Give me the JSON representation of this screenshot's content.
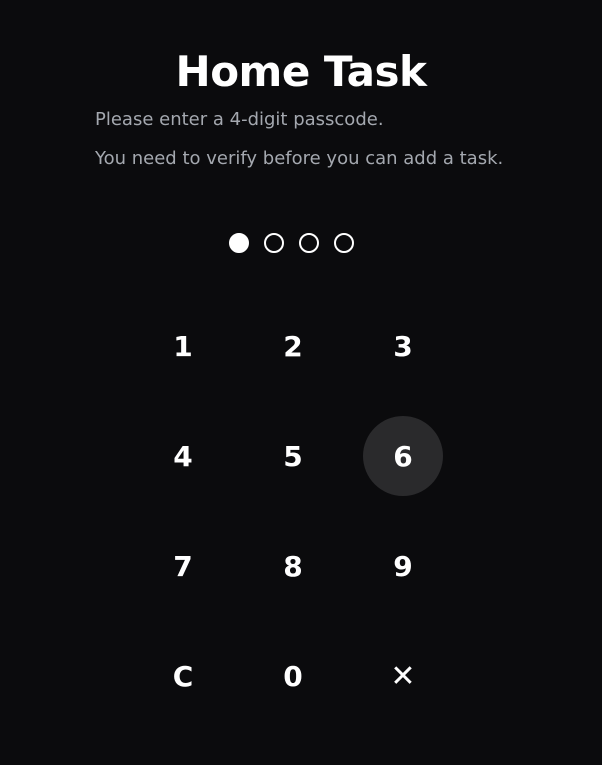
{
  "app": {
    "title": "Home Task",
    "instruction": "Please enter a 4-digit passcode.",
    "note": "You need to verify before you can add a task."
  },
  "passcode": {
    "length": 4,
    "entered_count": 1
  },
  "keypad": {
    "keys": [
      "1",
      "2",
      "3",
      "4",
      "5",
      "6",
      "7",
      "8",
      "9",
      "C",
      "0",
      "✕"
    ],
    "pressed_key": "6"
  },
  "colors": {
    "background": "#0b0b0d",
    "text": "#ffffff",
    "muted_text": "#a4a8af",
    "pressed_key_bg": "#2a2a2c"
  }
}
